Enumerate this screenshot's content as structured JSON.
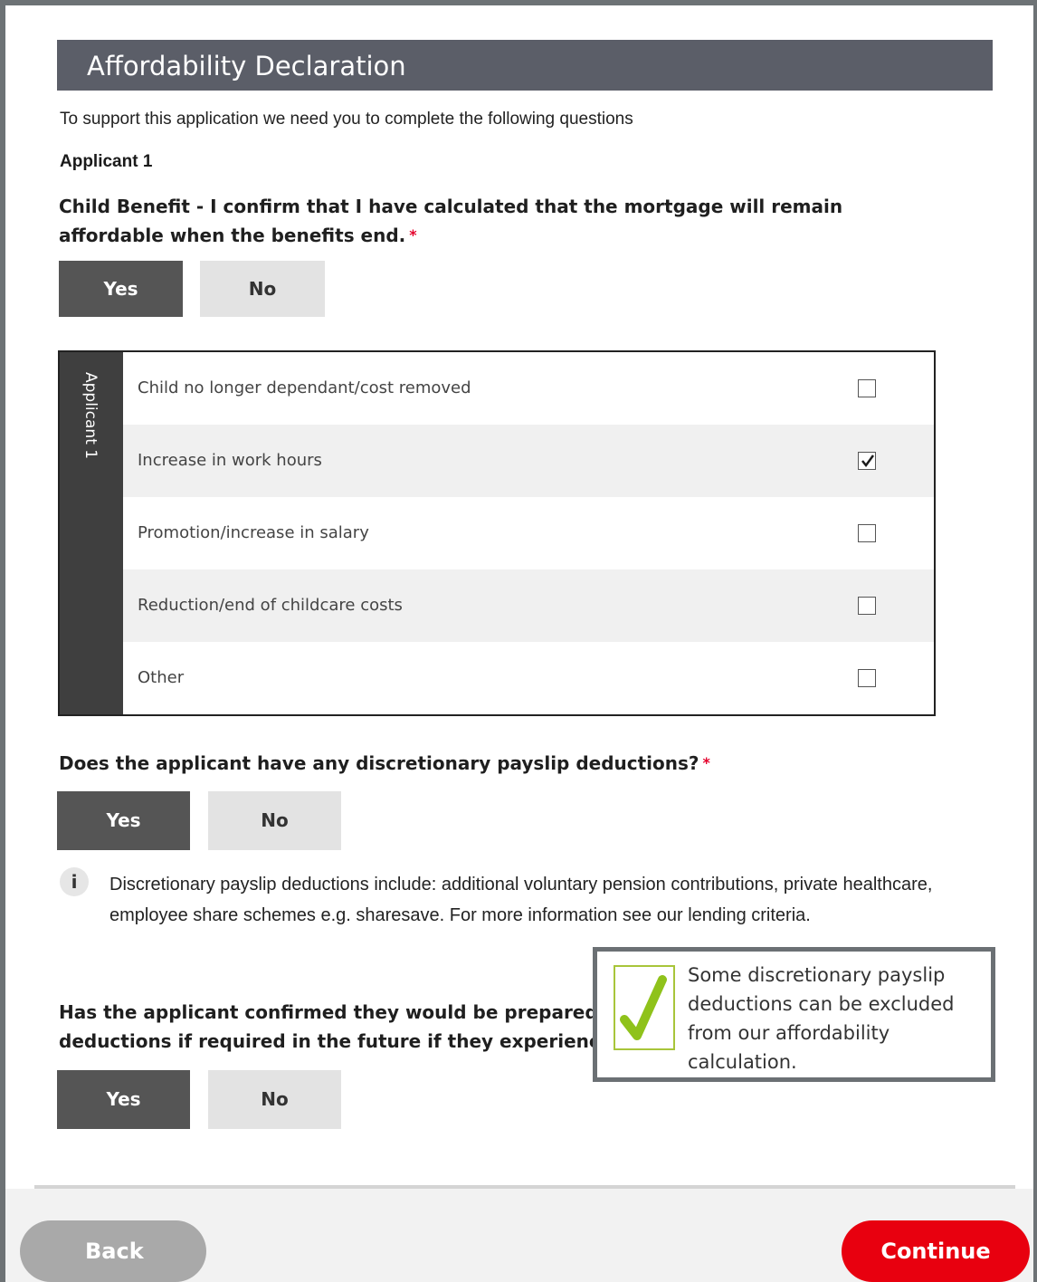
{
  "section": {
    "title": "Affordability Declaration",
    "intro": "To support this application we need you to complete the following questions",
    "applicant_title": "Applicant 1"
  },
  "q1": {
    "text": "Child Benefit - I confirm that I have calculated that the mortgage will remain affordable when the benefits end.",
    "required_marker": "*",
    "yes_label": "Yes",
    "no_label": "No",
    "selected": "Yes"
  },
  "checklist": {
    "side_label": "Applicant 1",
    "items": [
      {
        "label": "Child no longer dependant/cost removed",
        "checked": false
      },
      {
        "label": "Increase in work hours",
        "checked": true
      },
      {
        "label": "Promotion/increase in salary",
        "checked": false
      },
      {
        "label": "Reduction/end of childcare costs",
        "checked": false
      },
      {
        "label": "Other",
        "checked": false
      }
    ]
  },
  "q2": {
    "text": "Does the applicant have any discretionary payslip deductions?",
    "required_marker": "*",
    "yes_label": "Yes",
    "no_label": "No",
    "selected": "Yes"
  },
  "info": {
    "icon": "i",
    "text": "Discretionary payslip deductions include: additional voluntary pension contributions, private healthcare, employee share schemes e.g. sharesave. For more information see our lending criteria."
  },
  "q3": {
    "line1": "Has the applicant confirmed they would be prepared",
    "line2": "deductions if required in the future if they experience",
    "yes_label": "Yes",
    "no_label": "No",
    "selected": "Yes"
  },
  "tooltip": {
    "text": "Some discretionary payslip deductions can be excluded from our affordability calculation.",
    "accent_color": "#a8c53a"
  },
  "footer": {
    "back_label": "Back",
    "continue_label": "Continue",
    "continue_color": "#e8000f"
  }
}
